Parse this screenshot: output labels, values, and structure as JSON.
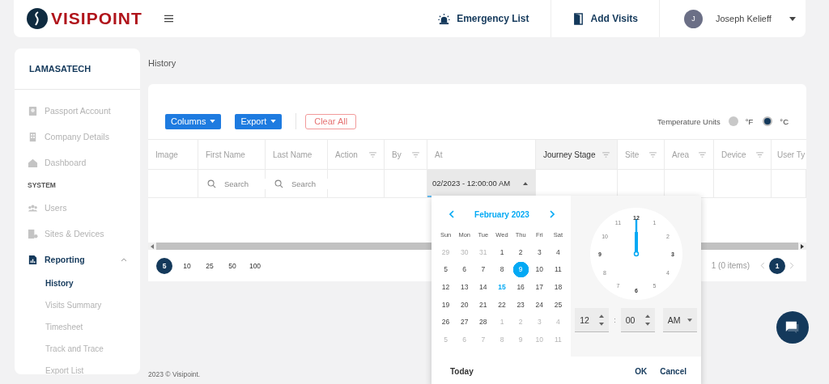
{
  "header": {
    "logo": "VISIPOINT",
    "actions": [
      {
        "label": "Emergency List"
      },
      {
        "label": "Add Visits"
      }
    ],
    "user": {
      "initial": "J",
      "name": "Joseph Kelieff"
    }
  },
  "sidebar": {
    "org": "LAMASATECH",
    "items": [
      {
        "kind": "item",
        "label": "Passport Account",
        "active": false
      },
      {
        "kind": "item",
        "label": "Company Details",
        "active": false
      },
      {
        "kind": "item",
        "label": "Dashboard",
        "active": false
      },
      {
        "kind": "heading",
        "label": "SYSTEM"
      },
      {
        "kind": "item",
        "label": "Users",
        "active": false
      },
      {
        "kind": "item",
        "label": "Sites & Devices",
        "active": false
      },
      {
        "kind": "group",
        "label": "Reporting",
        "active": true,
        "expanded": true,
        "children": [
          {
            "label": "History",
            "selected": true
          },
          {
            "label": "Visits Summary",
            "selected": false
          },
          {
            "label": "Timesheet",
            "selected": false
          },
          {
            "label": "Track and Trace",
            "selected": false
          },
          {
            "label": "Export List",
            "selected": false
          }
        ]
      }
    ]
  },
  "breadcrumb": "History",
  "toolbar": {
    "buttons": [
      {
        "label": "Columns",
        "kind": "dropdown"
      },
      {
        "label": "Export",
        "kind": "dropdown"
      },
      {
        "label": "Clear All",
        "kind": "outline"
      }
    ],
    "temperature": {
      "label": "Temperature Units",
      "options": [
        {
          "label": "°F",
          "selected": false
        },
        {
          "label": "°C",
          "selected": true
        }
      ]
    }
  },
  "table": {
    "columns": [
      {
        "label": "Image",
        "filterable": false,
        "highlighted": false,
        "kind": "plain"
      },
      {
        "label": "First Name",
        "filterable": false,
        "highlighted": false,
        "kind": "search",
        "placeholder": "Search"
      },
      {
        "label": "Last Name",
        "filterable": false,
        "highlighted": false,
        "kind": "search",
        "placeholder": "Search"
      },
      {
        "label": "Action",
        "filterable": true,
        "highlighted": false,
        "kind": "plain"
      },
      {
        "label": "By",
        "filterable": true,
        "highlighted": false,
        "kind": "plain"
      },
      {
        "label": "At",
        "filterable": false,
        "highlighted": false,
        "kind": "datetime",
        "value": "02/2023 - 12:00:00 AM"
      },
      {
        "label": "Journey Stage",
        "filterable": true,
        "highlighted": true,
        "kind": "plain"
      },
      {
        "label": "Site",
        "filterable": true,
        "highlighted": false,
        "kind": "plain"
      },
      {
        "label": "Area",
        "filterable": true,
        "highlighted": false,
        "kind": "plain"
      },
      {
        "label": "Device",
        "filterable": true,
        "highlighted": false,
        "kind": "plain"
      },
      {
        "label": "User Ty",
        "filterable": false,
        "highlighted": false,
        "kind": "plain"
      }
    ]
  },
  "pager": {
    "sizes": [
      {
        "label": "5",
        "selected": true
      },
      {
        "label": "10",
        "selected": false
      },
      {
        "label": "25",
        "selected": false
      },
      {
        "label": "50",
        "selected": false
      },
      {
        "label": "100",
        "selected": false
      }
    ],
    "summary": "1 (0 items)",
    "pages": [
      {
        "label": "1",
        "selected": true
      }
    ]
  },
  "picker": {
    "month": "February 2023",
    "weekdays": [
      "Sun",
      "Mon",
      "Tue",
      "Wed",
      "Thu",
      "Fri",
      "Sat"
    ],
    "weeks": [
      [
        {
          "day": "29",
          "outside": true,
          "selected": false,
          "today": false
        },
        {
          "day": "30",
          "outside": true,
          "selected": false,
          "today": false
        },
        {
          "day": "31",
          "outside": true,
          "selected": false,
          "today": false
        },
        {
          "day": "1",
          "outside": false,
          "selected": false,
          "today": false
        },
        {
          "day": "2",
          "outside": false,
          "selected": false,
          "today": false
        },
        {
          "day": "3",
          "outside": false,
          "selected": false,
          "today": false
        },
        {
          "day": "4",
          "outside": false,
          "selected": false,
          "today": false
        }
      ],
      [
        {
          "day": "5",
          "outside": false,
          "selected": false,
          "today": false
        },
        {
          "day": "6",
          "outside": false,
          "selected": false,
          "today": false
        },
        {
          "day": "7",
          "outside": false,
          "selected": false,
          "today": false
        },
        {
          "day": "8",
          "outside": false,
          "selected": false,
          "today": false
        },
        {
          "day": "9",
          "outside": false,
          "selected": true,
          "today": false
        },
        {
          "day": "10",
          "outside": false,
          "selected": false,
          "today": false
        },
        {
          "day": "11",
          "outside": false,
          "selected": false,
          "today": false
        }
      ],
      [
        {
          "day": "12",
          "outside": false,
          "selected": false,
          "today": false
        },
        {
          "day": "13",
          "outside": false,
          "selected": false,
          "today": false
        },
        {
          "day": "14",
          "outside": false,
          "selected": false,
          "today": false
        },
        {
          "day": "15",
          "outside": false,
          "selected": false,
          "today": true
        },
        {
          "day": "16",
          "outside": false,
          "selected": false,
          "today": false
        },
        {
          "day": "17",
          "outside": false,
          "selected": false,
          "today": false
        },
        {
          "day": "18",
          "outside": false,
          "selected": false,
          "today": false
        }
      ],
      [
        {
          "day": "19",
          "outside": false,
          "selected": false,
          "today": false
        },
        {
          "day": "20",
          "outside": false,
          "selected": false,
          "today": false
        },
        {
          "day": "21",
          "outside": false,
          "selected": false,
          "today": false
        },
        {
          "day": "22",
          "outside": false,
          "selected": false,
          "today": false
        },
        {
          "day": "23",
          "outside": false,
          "selected": false,
          "today": false
        },
        {
          "day": "24",
          "outside": false,
          "selected": false,
          "today": false
        },
        {
          "day": "25",
          "outside": false,
          "selected": false,
          "today": false
        }
      ],
      [
        {
          "day": "26",
          "outside": false,
          "selected": false,
          "today": false
        },
        {
          "day": "27",
          "outside": false,
          "selected": false,
          "today": false
        },
        {
          "day": "28",
          "outside": false,
          "selected": false,
          "today": false
        },
        {
          "day": "1",
          "outside": true,
          "selected": false,
          "today": false
        },
        {
          "day": "2",
          "outside": true,
          "selected": false,
          "today": false
        },
        {
          "day": "3",
          "outside": true,
          "selected": false,
          "today": false
        },
        {
          "day": "4",
          "outside": true,
          "selected": false,
          "today": false
        }
      ],
      [
        {
          "day": "5",
          "outside": true,
          "selected": false,
          "today": false
        },
        {
          "day": "6",
          "outside": true,
          "selected": false,
          "today": false
        },
        {
          "day": "7",
          "outside": true,
          "selected": false,
          "today": false
        },
        {
          "day": "8",
          "outside": true,
          "selected": false,
          "today": false
        },
        {
          "day": "9",
          "outside": true,
          "selected": false,
          "today": false
        },
        {
          "day": "10",
          "outside": true,
          "selected": false,
          "today": false
        },
        {
          "day": "11",
          "outside": true,
          "selected": false,
          "today": false
        }
      ]
    ],
    "clock_numbers": [
      "12",
      "1",
      "2",
      "3",
      "4",
      "5",
      "6",
      "7",
      "8",
      "9",
      "10",
      "11"
    ],
    "time": {
      "hour": "12",
      "separator": ":",
      "minute": "00",
      "period": "AM"
    },
    "actions": [
      "Today",
      "OK",
      "Cancel"
    ]
  },
  "footer": "2023 © Visipoint."
}
